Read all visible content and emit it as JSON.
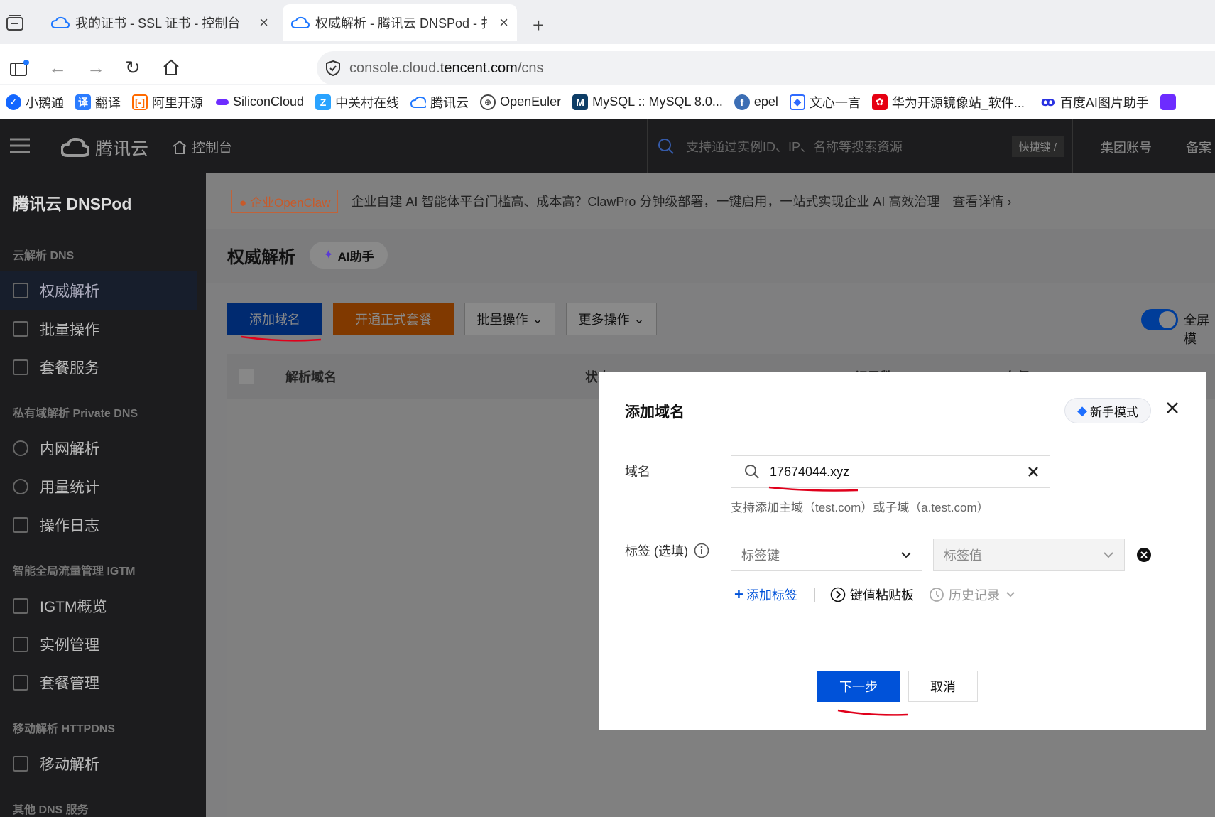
{
  "browser": {
    "tabs": [
      {
        "title": "我的证书 - SSL 证书 - 控制台"
      },
      {
        "title": "权威解析 - 腾讯云 DNSPod - 扌"
      }
    ],
    "url_prefix": "console.cloud.",
    "url_host": "tencent.com",
    "url_path": "/cns",
    "bookmarks": [
      "小鹅通",
      "翻译",
      "阿里开源",
      "SiliconCloud",
      "中关村在线",
      "腾讯云",
      "OpenEuler",
      "MySQL :: MySQL 8.0...",
      "epel",
      "文心一言",
      "华为开源镜像站_软件...",
      "百度AI图片助手"
    ]
  },
  "header": {
    "brand": "腾讯云",
    "console": "控制台",
    "search_placeholder": "支持通过实例ID、IP、名称等搜索资源",
    "shortcut": "快捷键 /",
    "group_account": "集团账号",
    "beian": "备案"
  },
  "sidebar": {
    "title": "腾讯云 DNSPod",
    "sections": [
      {
        "label": "云解析 DNS",
        "items": [
          "权威解析",
          "批量操作",
          "套餐服务"
        ]
      },
      {
        "label": "私有域解析 Private DNS",
        "items": [
          "内网解析",
          "用量统计",
          "操作日志"
        ]
      },
      {
        "label": "智能全局流量管理 IGTM",
        "items": [
          "IGTM概览",
          "实例管理",
          "套餐管理"
        ]
      },
      {
        "label": "移动解析 HTTPDNS",
        "items": [
          "移动解析"
        ]
      },
      {
        "label": "其他 DNS 服务",
        "items": []
      }
    ]
  },
  "banner": {
    "tag": "企业OpenClaw",
    "text": "企业自建 AI 智能体平台门槛高、成本高？ClawPro 分钟级部署，一键启用，一站式实现企业 AI 高效治理",
    "link": "查看详情"
  },
  "page": {
    "title": "权威解析",
    "ai_button": "AI助手",
    "toolbar": {
      "add_domain": "添加域名",
      "open_package": "开通正式套餐",
      "batch": "批量操作",
      "more": "更多操作",
      "fullscreen": "全屏模"
    },
    "table_headers": [
      "解析域名",
      "状态",
      "记录数",
      "套餐"
    ]
  },
  "modal": {
    "title": "添加域名",
    "newbie_mode": "新手模式",
    "domain_label": "域名",
    "domain_value": "17674044.xyz",
    "domain_hint": "支持添加主域（test.com）或子域（a.test.com）",
    "tag_label": "标签 (选填)",
    "tag_key_placeholder": "标签键",
    "tag_value_placeholder": "标签值",
    "add_tag": "添加标签",
    "kv_paste": "键值粘贴板",
    "history": "历史记录",
    "next": "下一步",
    "cancel": "取消"
  },
  "colors": {
    "primary": "#0052d9",
    "orange": "#ff7200",
    "annotation_red": "#e0001b"
  }
}
